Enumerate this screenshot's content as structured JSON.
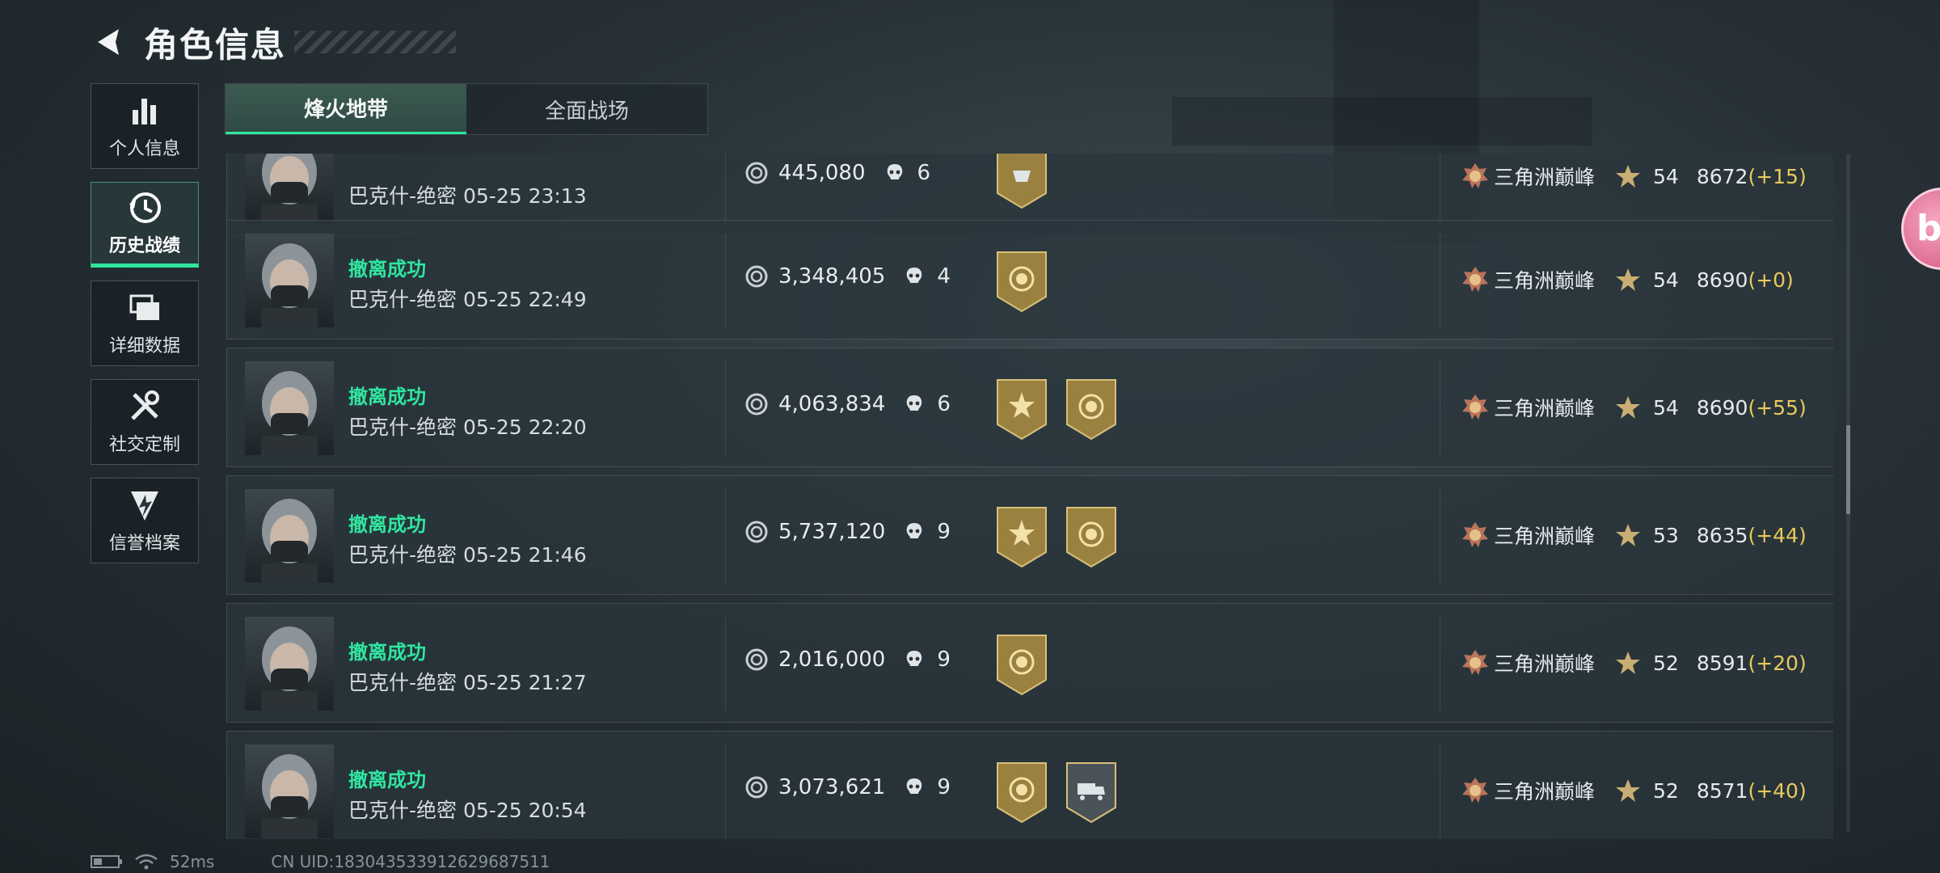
{
  "header": {
    "title": "角色信息"
  },
  "sidebar": {
    "items": [
      {
        "label": "个人信息",
        "icon": "bar-chart-icon"
      },
      {
        "label": "历史战绩",
        "icon": "history-clock-icon"
      },
      {
        "label": "详细数据",
        "icon": "folders-icon"
      },
      {
        "label": "社交定制",
        "icon": "tools-icon"
      },
      {
        "label": "信誉档案",
        "icon": "shield-lightning-icon"
      }
    ]
  },
  "tabs": [
    {
      "label": "烽火地带"
    },
    {
      "label": "全面战场"
    }
  ],
  "records": [
    {
      "status": "",
      "map": "巴克什-绝密",
      "time": "05-25 23:13",
      "value": "445,080",
      "kills": "6",
      "badges": [
        "partial"
      ],
      "rank": "三角洲巅峰",
      "level": "54",
      "score": "8672",
      "delta": "(+15)"
    },
    {
      "status": "撤离成功",
      "map": "巴克什-绝密",
      "time": "05-25 22:49",
      "value": "3,348,405",
      "kills": "4",
      "badges": [
        "gold-seal"
      ],
      "rank": "三角洲巅峰",
      "level": "54",
      "score": "8690",
      "delta": "(+0)"
    },
    {
      "status": "撤离成功",
      "map": "巴克什-绝密",
      "time": "05-25 22:20",
      "value": "4,063,834",
      "kills": "6",
      "badges": [
        "gold-sun",
        "gold-seal"
      ],
      "rank": "三角洲巅峰",
      "level": "54",
      "score": "8690",
      "delta": "(+55)"
    },
    {
      "status": "撤离成功",
      "map": "巴克什-绝密",
      "time": "05-25 21:46",
      "value": "5,737,120",
      "kills": "9",
      "badges": [
        "gold-sun",
        "gold-seal"
      ],
      "rank": "三角洲巅峰",
      "level": "53",
      "score": "8635",
      "delta": "(+44)"
    },
    {
      "status": "撤离成功",
      "map": "巴克什-绝密",
      "time": "05-25 21:27",
      "value": "2,016,000",
      "kills": "9",
      "badges": [
        "gold-seal"
      ],
      "rank": "三角洲巅峰",
      "level": "52",
      "score": "8591",
      "delta": "(+20)"
    },
    {
      "status": "撤离成功",
      "map": "巴克什-绝密",
      "time": "05-25 20:54",
      "value": "3,073,621",
      "kills": "9",
      "badges": [
        "gold-seal",
        "gray-truck"
      ],
      "rank": "三角洲巅峰",
      "level": "52",
      "score": "8571",
      "delta": "(+40)"
    }
  ],
  "footer": {
    "ping": "52ms",
    "uid": "CN UID:18304353391262968751​1"
  },
  "edge_bubble": {
    "text": "bi"
  },
  "colors": {
    "accent": "#2fe6a0",
    "gold": "#e9c95c",
    "badge_gold": "#9a8140",
    "badge_gray": "#4a5358"
  }
}
